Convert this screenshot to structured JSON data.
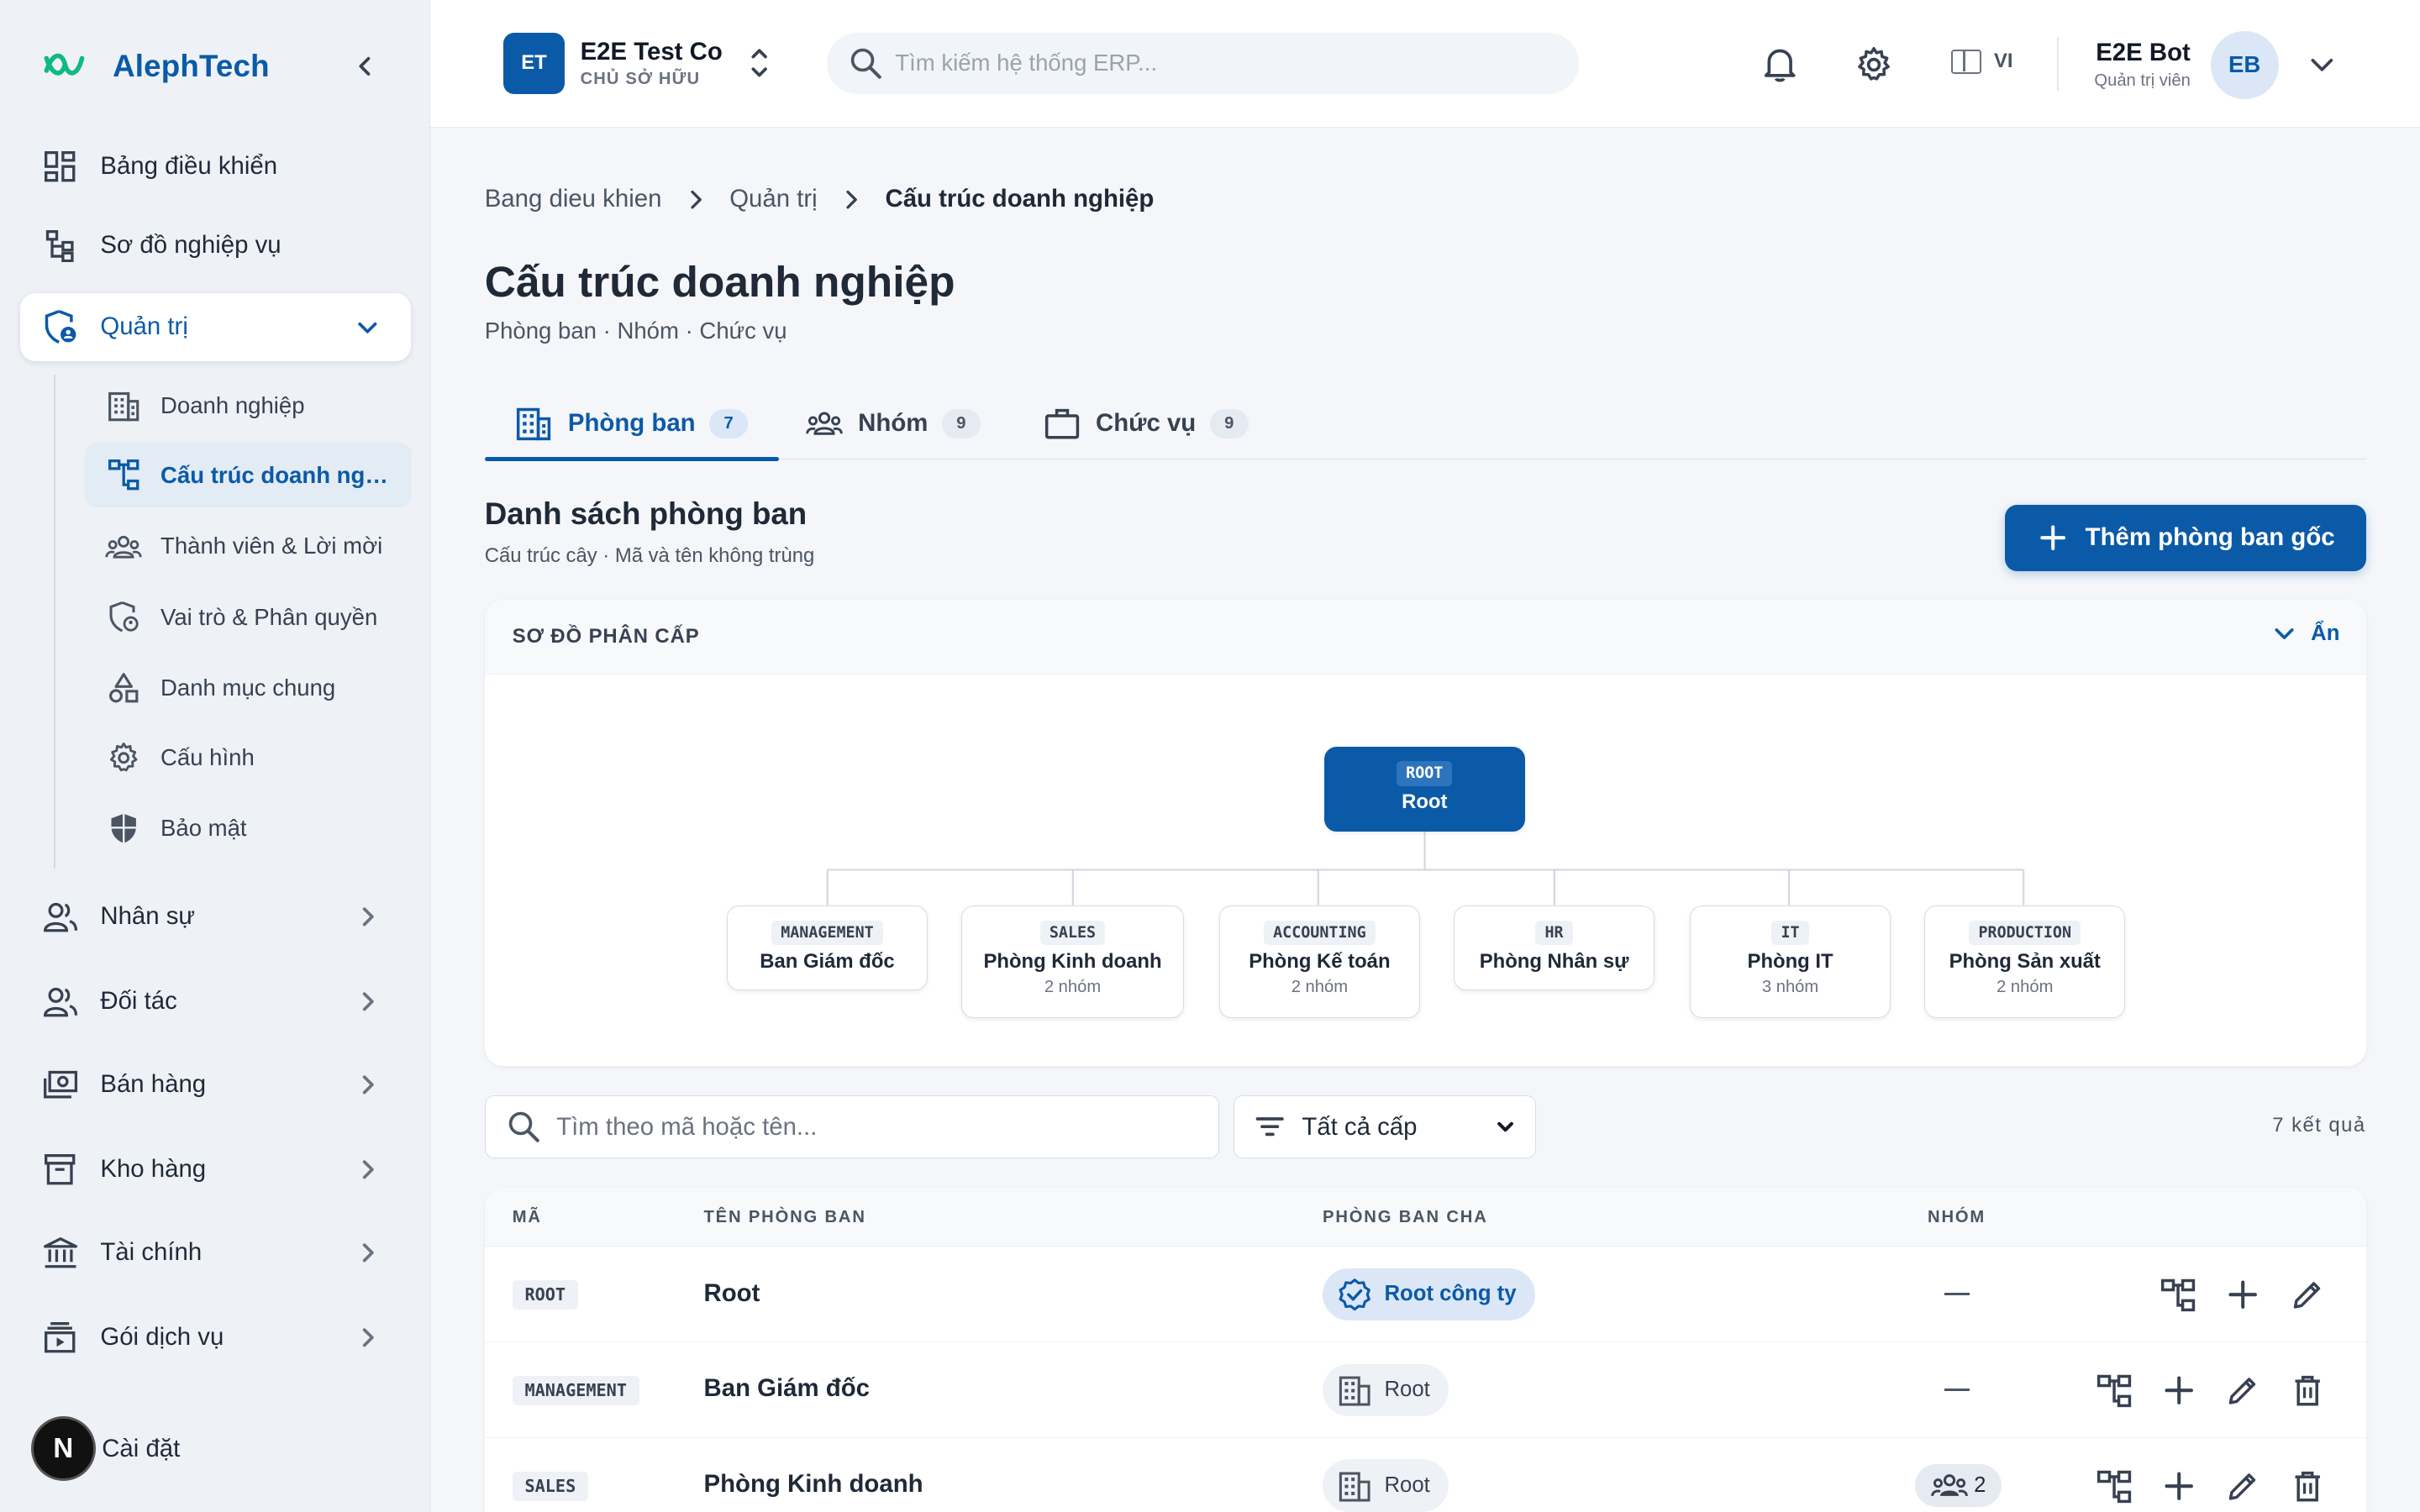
{
  "brand": {
    "name": "AlephTech"
  },
  "sidebar": {
    "items": [
      {
        "label": "Bảng điều khiển"
      },
      {
        "label": "Sơ đồ nghiệp vụ"
      },
      {
        "label": "Quản trị"
      },
      {
        "label": "Nhân sự"
      },
      {
        "label": "Đối tác"
      },
      {
        "label": "Bán hàng"
      },
      {
        "label": "Kho hàng"
      },
      {
        "label": "Tài chính"
      },
      {
        "label": "Gói dịch vụ"
      },
      {
        "label": "Cài đặt"
      }
    ],
    "sub_items": [
      {
        "label": "Doanh nghiệp"
      },
      {
        "label": "Cấu trúc doanh nghiệp"
      },
      {
        "label": "Thành viên & Lời mời"
      },
      {
        "label": "Vai trò & Phân quyền"
      },
      {
        "label": "Danh mục chung"
      },
      {
        "label": "Cấu hình"
      },
      {
        "label": "Bảo mật"
      }
    ],
    "fab_letter": "N"
  },
  "header": {
    "company_initials": "ET",
    "company_name": "E2E Test Co",
    "company_role": "CHỦ SỞ HỮU",
    "search_placeholder": "Tìm kiếm hệ thống ERP...",
    "lang": "VI",
    "user_name": "E2E Bot",
    "user_role": "Quản trị viên",
    "user_initials": "EB"
  },
  "breadcrumb": [
    "Bang dieu khien",
    "Quản trị",
    "Cấu trúc doanh nghiệp"
  ],
  "page": {
    "title": "Cấu trúc doanh nghiệp",
    "subtitle": "Phòng ban · Nhóm · Chức vụ"
  },
  "tabs": [
    {
      "label": "Phòng ban",
      "count": "7"
    },
    {
      "label": "Nhóm",
      "count": "9"
    },
    {
      "label": "Chức vụ",
      "count": "9"
    }
  ],
  "section": {
    "title": "Danh sách phòng ban",
    "subtitle": "Cấu trúc cây · Mã và tên không trùng",
    "add_button": "Thêm phòng ban gốc"
  },
  "tree": {
    "heading": "SƠ ĐỒ PHÂN CẤP",
    "toggle": "Ẩn",
    "root": {
      "code": "ROOT",
      "name": "Root"
    },
    "children": [
      {
        "code": "MANAGEMENT",
        "name": "Ban Giám đốc",
        "meta": ""
      },
      {
        "code": "SALES",
        "name": "Phòng Kinh doanh",
        "meta": "2 nhóm"
      },
      {
        "code": "ACCOUNTING",
        "name": "Phòng Kế toán",
        "meta": "2 nhóm"
      },
      {
        "code": "HR",
        "name": "Phòng Nhân sự",
        "meta": ""
      },
      {
        "code": "IT",
        "name": "Phòng IT",
        "meta": "3 nhóm"
      },
      {
        "code": "PRODUCTION",
        "name": "Phòng Sản xuất",
        "meta": "2 nhóm"
      }
    ]
  },
  "filters": {
    "search_placeholder": "Tìm theo mã hoặc tên...",
    "level": "Tất cả cấp",
    "result_count": "7 kết quả"
  },
  "table": {
    "columns": [
      "MÃ",
      "TÊN PHÒNG BAN",
      "PHÒNG BAN CHA",
      "NHÓM"
    ],
    "rows": [
      {
        "code": "ROOT",
        "name": "Root",
        "parent": "Root công ty",
        "groups": ""
      },
      {
        "code": "MANAGEMENT",
        "name": "Ban Giám đốc",
        "parent": "Root",
        "groups": ""
      },
      {
        "code": "SALES",
        "name": "Phòng Kinh doanh",
        "parent": "Root",
        "groups": "2"
      }
    ]
  },
  "colors": {
    "primary": "#0b5aa8",
    "logo": "#10b981"
  }
}
